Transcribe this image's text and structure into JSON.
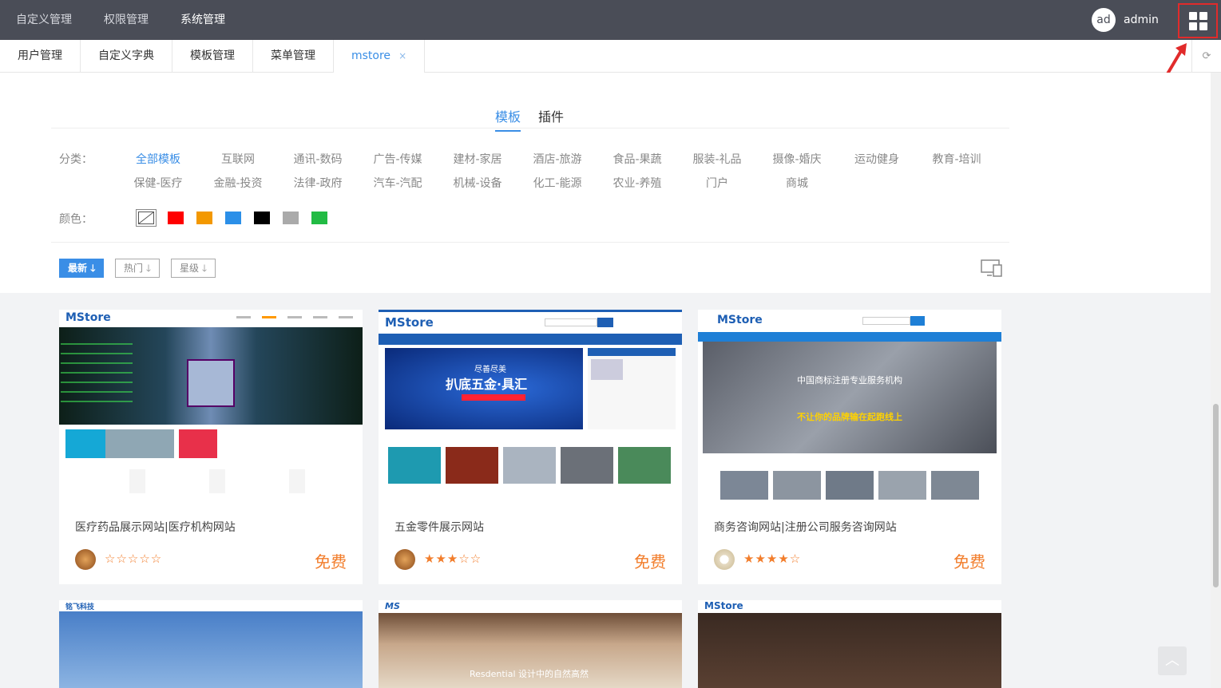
{
  "topnav": {
    "items": [
      {
        "label": "自定义管理",
        "active": false
      },
      {
        "label": "权限管理",
        "active": false
      },
      {
        "label": "系统管理",
        "active": true
      }
    ],
    "avatar_text": "ad",
    "username": "admin",
    "apps_icon": "grid-apps-icon"
  },
  "tabs": [
    {
      "label": "用户管理"
    },
    {
      "label": "自定义字典"
    },
    {
      "label": "模板管理"
    },
    {
      "label": "菜单管理"
    },
    {
      "label": "mstore",
      "close": "×",
      "active": true
    }
  ],
  "refresh_icon": "⟳",
  "type_tabs": [
    {
      "label": "模板",
      "active": true
    },
    {
      "label": "插件",
      "active": false
    }
  ],
  "filters": {
    "category_label": "分类：",
    "categories_row1": [
      "全部模板",
      "互联网",
      "通讯-数码",
      "广告-传媒",
      "建材-家居",
      "酒店-旅游",
      "食品-果蔬",
      "服装-礼品",
      "摄像-婚庆",
      "运动健身",
      "教育-培训"
    ],
    "categories_row2": [
      "保健-医疗",
      "金融-投资",
      "法律-政府",
      "汽车-汽配",
      "机械-设备",
      "化工-能源",
      "农业-养殖",
      "门户",
      "商城"
    ],
    "active_category": "全部模板",
    "color_label": "颜色：",
    "colors": [
      "#ff0000",
      "#f39800",
      "#2b8fe8",
      "#000000",
      "#aaaaaa",
      "#22bb44"
    ]
  },
  "sort": {
    "latest": "最新",
    "hot": "热门",
    "rating": "星级"
  },
  "cards": [
    {
      "title": "医疗药品展示网站|医疗机构网站",
      "stars": "☆☆☆☆☆",
      "price": "免费",
      "logo": "MStore"
    },
    {
      "title": "五金零件展示网站",
      "stars": "★★★☆☆",
      "price": "免费",
      "logo": "MStore",
      "banner_a": "尽善尽美",
      "banner_b": "扒底五金·具汇"
    },
    {
      "title": "商务咨询网站|注册公司服务咨询网站",
      "stars": "★★★★☆",
      "price": "免费",
      "logo": "MStore",
      "banner_a": "中国商标注册专业服务机构",
      "banner_b": "不让你的品牌输在起跑线上"
    },
    {
      "logo": "铭飞科技"
    },
    {
      "logo": "MS",
      "banner_a": "Resdential 设计中的自然高然"
    },
    {
      "logo": "MStore"
    }
  ],
  "totop_icon": "︿"
}
